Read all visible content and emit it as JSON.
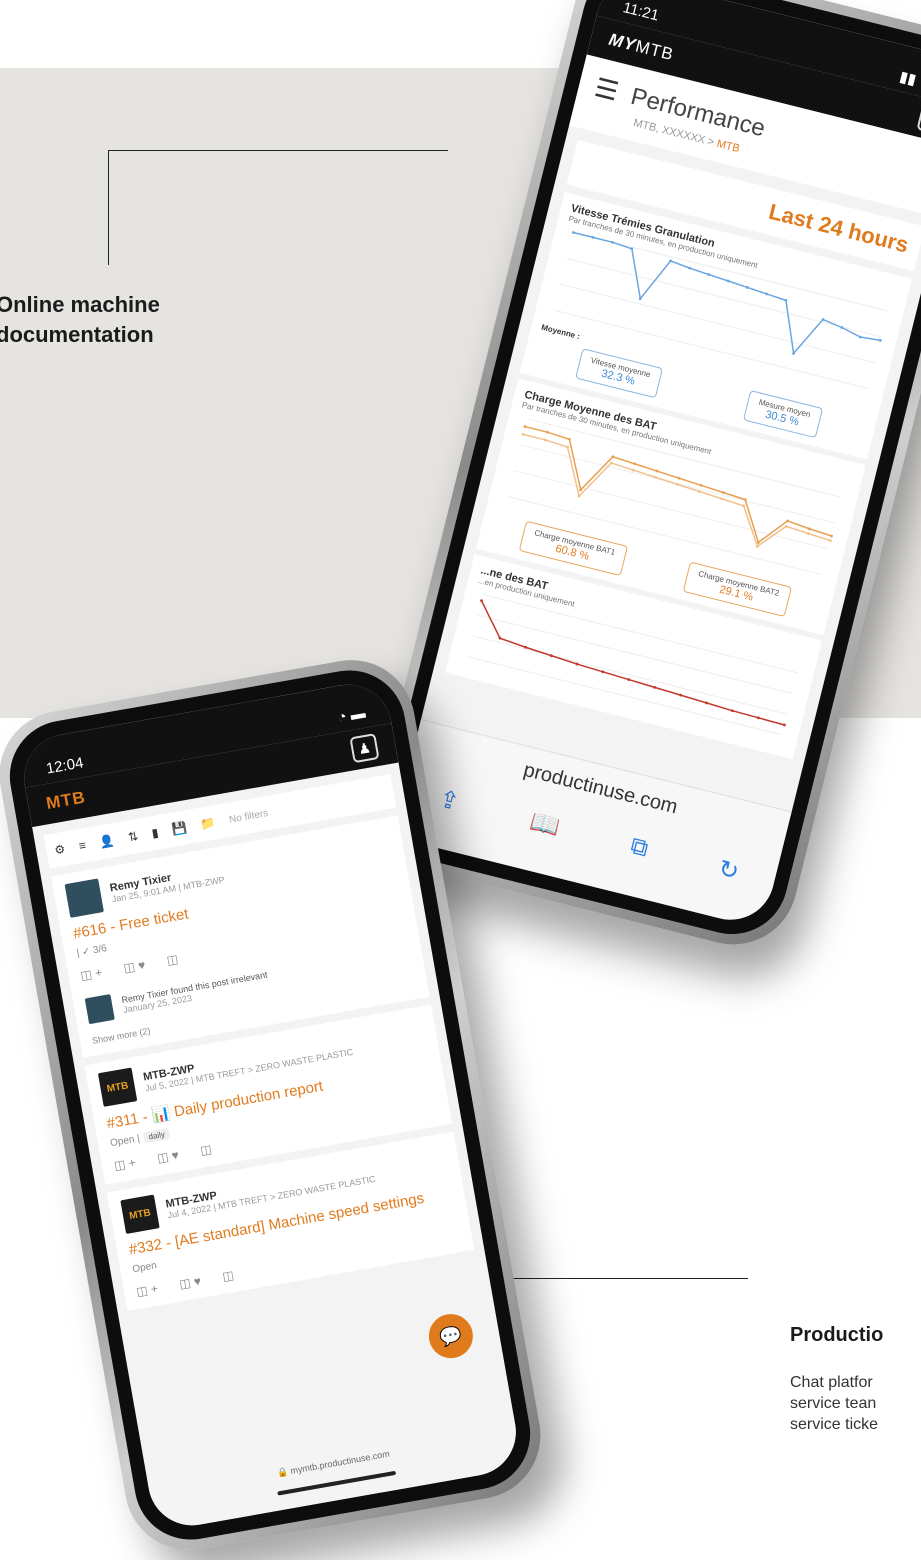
{
  "callouts": {
    "documentation": {
      "line1": "Online machine",
      "line2": "documentation"
    },
    "production": {
      "title": "Productio",
      "text1": "Chat platfor",
      "text2": "service tean",
      "text3": "service ticke"
    }
  },
  "back_phone": {
    "time": "11:21",
    "logo_a": "MY",
    "logo_b": "MTB",
    "page_title": "Performance",
    "breadcrumb_a": "MTB, XXXXXX >",
    "breadcrumb_b": "MTB",
    "period": "Last 24 hours",
    "chart1": {
      "title": "Vitesse Trémies Granulation",
      "subtitle": "Par tranches de 30 minutes, en production uniquement",
      "moyenne_label": "Moyenne :",
      "stat1_label": "Vitesse moyenne",
      "stat1_value": "32.3 %",
      "stat2_label": "Mesure moyen",
      "stat2_value": "30.5 %"
    },
    "chart2": {
      "title": "Charge Moyenne des BAT",
      "subtitle": "Par tranches de 30 minutes, en production uniquement",
      "stat1_label": "Charge moyenne BAT1",
      "stat1_value": "60.8 %",
      "stat2_label": "Charge moyenne BAT2",
      "stat2_value": "29.1 %"
    },
    "chart3": {
      "title": "...ne des BAT",
      "subtitle": "...en production uniquement"
    },
    "url": "productinuse.com",
    "safari": {
      "share": "⇪",
      "book": "📖",
      "tabs": "⧉",
      "reload": "↻"
    }
  },
  "chart_data": [
    {
      "type": "line",
      "title": "Vitesse Trémies Granulation",
      "series": [
        {
          "name": "",
          "values": [
            100,
            100,
            100,
            98,
            40,
            95,
            92,
            90,
            88,
            86,
            84,
            82,
            20,
            70,
            66,
            60,
            62
          ]
        }
      ],
      "color": "#6aa6e0"
    },
    {
      "type": "line",
      "title": "Charge Moyenne des BAT",
      "series": [
        {
          "name": "BAT1",
          "values": [
            90,
            90,
            88,
            30,
            80,
            78,
            76,
            74,
            72,
            70,
            68,
            20,
            55,
            52,
            50
          ]
        },
        {
          "name": "BAT2",
          "values": [
            80,
            80,
            78,
            22,
            72,
            70,
            68,
            66,
            64,
            62,
            60,
            15,
            48,
            46,
            44
          ]
        }
      ],
      "colors": [
        "#e8a050",
        "#f2c08a"
      ]
    },
    {
      "type": "line",
      "title": "",
      "series": [
        {
          "name": "",
          "values": [
            90,
            40,
            36,
            33,
            30,
            28,
            26,
            24,
            22,
            20,
            18,
            17,
            16
          ]
        }
      ],
      "color": "#c0392b"
    }
  ],
  "front_phone": {
    "time": "12:04",
    "logo": "MTB",
    "filters": {
      "gear": "⚙",
      "list": "≡",
      "user": "👤",
      "sort": "⇅",
      "status": "▮",
      "save": "💾",
      "folder": "📁",
      "label": "No filters"
    },
    "posts": [
      {
        "author": "Remy Tixier",
        "meta": "Jan 25, 9:01 AM | MTB-ZWP",
        "title": "#616 - Free ticket",
        "status": "| ✓ 3/6",
        "irrelevant": "Remy Tixier found this post irrelevant",
        "irr_date": "January 25, 2023",
        "show_more": "Show more (2)"
      },
      {
        "author": "MTB-ZWP",
        "meta": "Jul 5, 2022 | MTB TREFT > ZERO WASTE PLASTIC",
        "title": "#311 - 📊 Daily production report",
        "status": "Open |",
        "tag": "daily"
      },
      {
        "author": "MTB-ZWP",
        "meta": "Jul 4, 2022 | MTB TREFT > ZERO WASTE PLASTIC",
        "title": "#332 - [AE standard] Machine speed settings",
        "status": "Open"
      }
    ],
    "react": {
      "a": "◫ +",
      "b": "◫ ♥",
      "c": "◫"
    },
    "fab_icon": "💬",
    "url": "🔒 mymtb.productinuse.com"
  }
}
